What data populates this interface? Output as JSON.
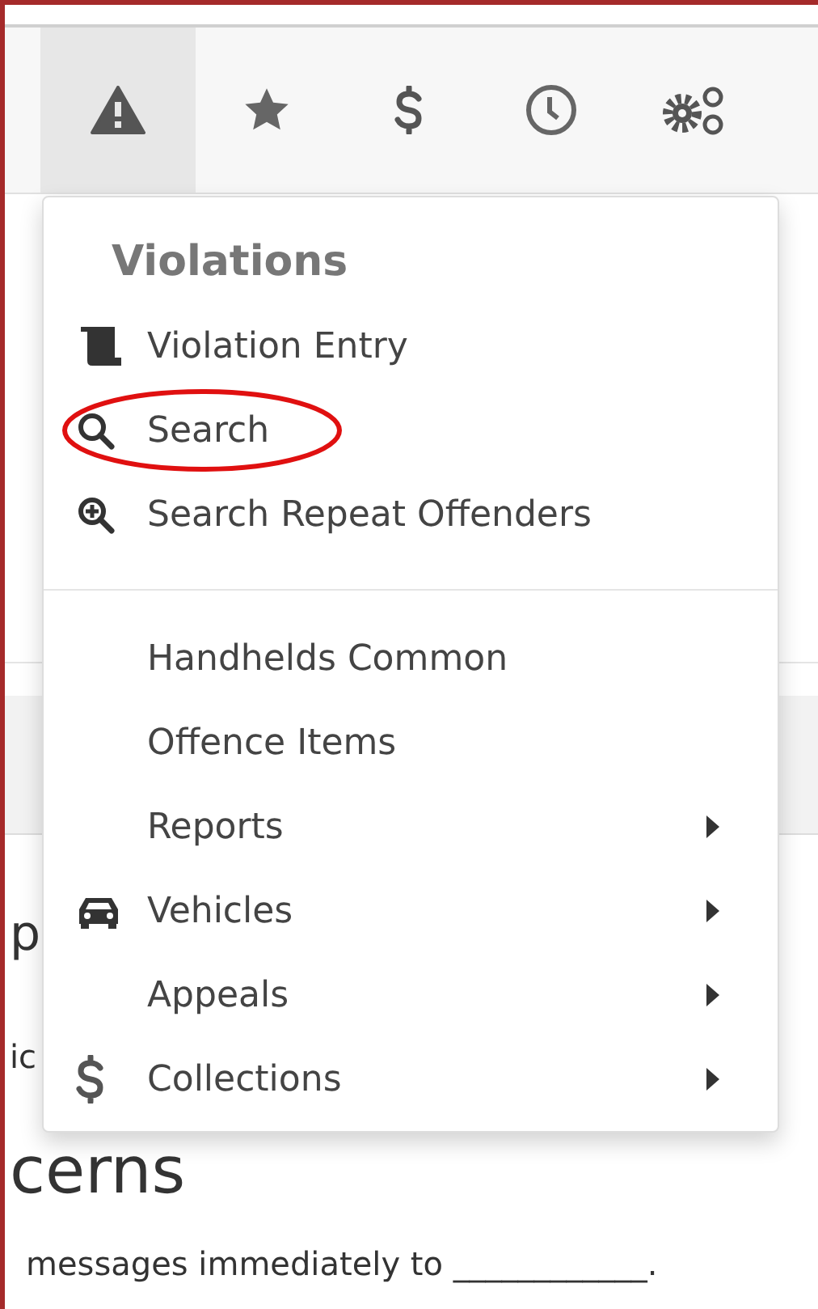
{
  "nav_tabs": [
    {
      "kind": "warning",
      "selected": true
    },
    {
      "kind": "star",
      "selected": false
    },
    {
      "kind": "dollar",
      "selected": false
    },
    {
      "kind": "clock",
      "selected": false
    },
    {
      "kind": "gears",
      "selected": false
    }
  ],
  "menu": {
    "title": "Violations",
    "groups": [
      [
        {
          "label": "Violation Entry",
          "kind": "scroll",
          "submenu": false,
          "circled": false
        },
        {
          "label": "Search",
          "kind": "search",
          "submenu": false,
          "circled": true
        },
        {
          "label": "Search Repeat Offenders",
          "kind": "search-plus",
          "submenu": false,
          "circled": false
        }
      ],
      [
        {
          "label": "Handhelds Common",
          "kind": "plain",
          "submenu": false,
          "circled": false
        },
        {
          "label": "Offence Items",
          "kind": "plain",
          "submenu": false,
          "circled": false
        },
        {
          "label": "Reports",
          "kind": "plain",
          "submenu": true,
          "circled": false
        },
        {
          "label": "Vehicles",
          "kind": "car",
          "submenu": true,
          "circled": false
        },
        {
          "label": "Appeals",
          "kind": "plain",
          "submenu": true,
          "circled": false
        },
        {
          "label": "Collections",
          "kind": "dollar",
          "submenu": true,
          "circled": false
        }
      ]
    ]
  },
  "background": {
    "fragment_1": "p",
    "fragment_2": "ic",
    "heading": "cerns",
    "paragraph": "messages immediately to ____________."
  }
}
